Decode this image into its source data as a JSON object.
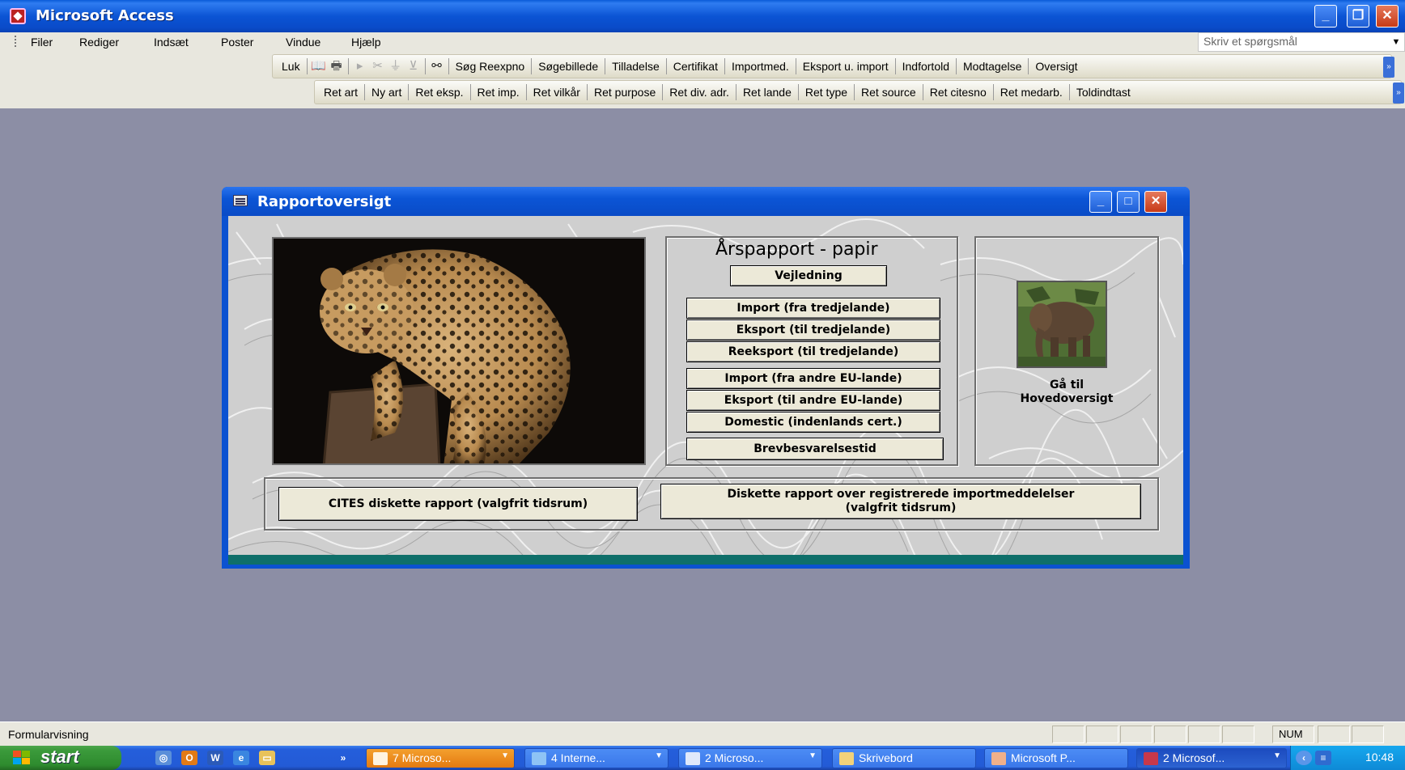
{
  "window": {
    "title": "Microsoft Access",
    "min": "_",
    "max": "❐",
    "close": "✕"
  },
  "menu": {
    "items": [
      "Filer",
      "Rediger",
      "Indsæt",
      "Poster",
      "Vindue",
      "Hjælp"
    ],
    "help_placeholder": "Skriv et spørgsmål"
  },
  "toolbar1": {
    "items": [
      "Luk",
      "Søg Reexpno",
      "Søgebillede",
      "Tilladelse",
      "Certifikat",
      "Importmed.",
      "Eksport u. import",
      "Indfortold",
      "Modtagelse",
      "Oversigt"
    ]
  },
  "toolbar2": {
    "items": [
      "Ret art",
      "Ny art",
      "Ret eksp.",
      "Ret imp.",
      "Ret vilkår",
      "Ret purpose",
      "Ret div. adr.",
      "Ret lande",
      "Ret type",
      "Ret source",
      "Ret citesno",
      "Ret medarb.",
      "Toldindtast"
    ]
  },
  "dialog": {
    "title": "Rapportoversigt",
    "section_title": "Årspapport - papir",
    "buttons": {
      "vejledning": "Vejledning",
      "import_tredje": "Import (fra tredjelande)",
      "eksport_tredje": "Eksport (til tredjelande)",
      "reeksport": "Reeksport (til tredjelande)",
      "import_eu": "Import (fra andre EU-lande)",
      "eksport_eu": "Eksport (til andre EU-lande)",
      "domestic": "Domestic (indenlands cert.)",
      "brevbesvarelse": "Brevbesvarelsestid",
      "cites_diskette": "CITES diskette rapport (valgfrit tidsrum)",
      "diskette_line1": "Diskette rapport over registrerede importmeddelelser",
      "diskette_line2": "(valgfrit tidsrum)"
    },
    "goto_line1": "Gå til",
    "goto_line2": "Hovedoversigt"
  },
  "status": {
    "text": "Formularvisning",
    "num": "NUM"
  },
  "taskbar": {
    "start": "start",
    "tasks": [
      "7 Microso...",
      "4 Interne...",
      "2 Microso...",
      "Skrivebord",
      "Microsoft P...",
      "2 Microsof..."
    ],
    "clock": "10:48"
  },
  "colors": {
    "xp_blue": "#0b52d1",
    "teal_footer": "#0f6f6a",
    "desktop": "#8c8ea5"
  }
}
